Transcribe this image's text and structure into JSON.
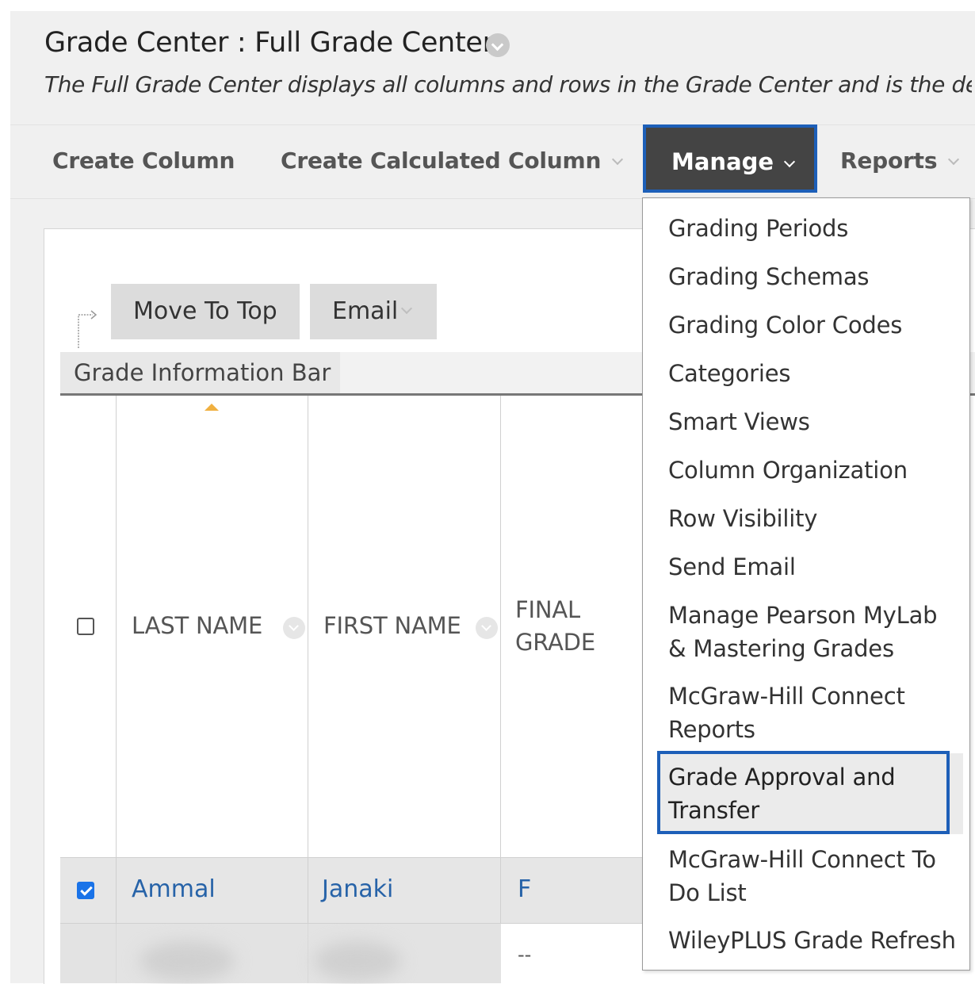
{
  "header": {
    "title": "Grade Center : Full Grade Center",
    "description": "The Full Grade Center displays all columns and rows in the Grade Center and is the defa"
  },
  "action_bar": {
    "create_column": "Create Column",
    "create_calculated_column": "Create Calculated Column",
    "manage": "Manage",
    "reports": "Reports"
  },
  "toolbar": {
    "move_to_top": "Move To Top",
    "email": "Email"
  },
  "info_bar": {
    "label": "Grade Information Bar"
  },
  "table": {
    "columns": {
      "last_name": "LAST NAME",
      "first_name": "FIRST NAME",
      "final_grade_line1": "FINAL",
      "final_grade_line2": "GRADE"
    },
    "rows": [
      {
        "checked": true,
        "last_name": "Ammal",
        "first_name": "Janaki",
        "final_grade": "F"
      },
      {
        "checked": false,
        "last_name": "",
        "first_name": "",
        "final_grade": "--"
      }
    ]
  },
  "manage_menu": {
    "items": [
      "Grading Periods",
      "Grading Schemas",
      "Grading Color Codes",
      "Categories",
      "Smart Views",
      "Column Organization",
      "Row Visibility",
      "Send Email",
      "Manage Pearson MyLab & Mastering Grades",
      "McGraw-Hill Connect Reports",
      "Grade Approval and Transfer",
      "McGraw-Hill Connect To Do List",
      "WileyPLUS Grade Refresh"
    ],
    "highlighted_index": 10
  },
  "colors": {
    "accent_frame": "#1d5fb8",
    "manage_bg": "#444444",
    "link": "#2763a8",
    "checkbox_checked": "#1a73e8",
    "sort_caret": "#f0b040"
  },
  "icons": {
    "title_info": "chevron-down-circle-icon",
    "sort": "sort-up-icon",
    "select_arrow": "corner-arrow-icon"
  }
}
